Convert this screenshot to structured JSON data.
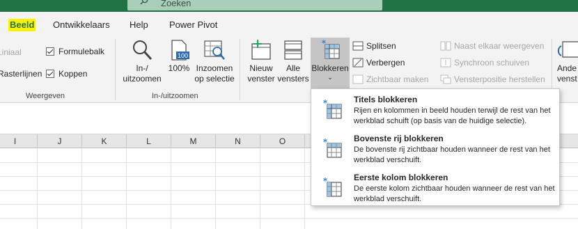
{
  "search": {
    "placeholder": "Zoeken"
  },
  "tabs": [
    {
      "label": "Beeld",
      "active": true
    },
    {
      "label": "Ontwikkelaars"
    },
    {
      "label": "Help"
    },
    {
      "label": "Power Pivot"
    }
  ],
  "weergeven": {
    "group_label": "Weergeven",
    "liniaal": "Liniaal",
    "rasterlijnen": "Rasterlijnen",
    "formulebalk": "Formulebalk",
    "koppen": "Koppen"
  },
  "zoom": {
    "group_label": "In-/uitzoomen",
    "zoom_label_1": "In-/",
    "zoom_label_2": "uitzoomen",
    "hundred_label": "100%",
    "hundred_icon_text": "100",
    "selection_label_1": "Inzoomen",
    "selection_label_2": "op selectie"
  },
  "window": {
    "new_window_1": "Nieuw",
    "new_window_2": "venster",
    "all_windows_1": "Alle",
    "all_windows_2": "vensters",
    "freeze": "Blokkeren",
    "split": "Splitsen",
    "hide": "Verbergen",
    "unhide": "Zichtbaar maken",
    "side_by_side": "Naast elkaar weergeven",
    "sync_scroll": "Synchroon schuiven",
    "reset_position": "Vensterpositie herstellen",
    "switch_partial": "Ande",
    "switch_partial_2": "venst"
  },
  "columns": [
    "I",
    "J",
    "K",
    "L",
    "M",
    "N",
    "O"
  ],
  "freeze_menu": [
    {
      "title": "Titels blokkeren",
      "description": "Rijen en kolommen in beeld houden terwijl de rest van het werkblad schuift (op basis van de huidige selectie)."
    },
    {
      "title": "Bovenste rij blokkeren",
      "description": "De bovenste rij zichtbaar houden wanneer de rest van het werkblad verschuift."
    },
    {
      "title": "Eerste kolom blokkeren",
      "description": "De eerste kolom zichtbaar houden wanneer de rest van het werkblad verschuift."
    }
  ],
  "colors": {
    "excel_green": "#217346",
    "highlight": "#fff200",
    "freeze_blue": "#4a90d9"
  }
}
